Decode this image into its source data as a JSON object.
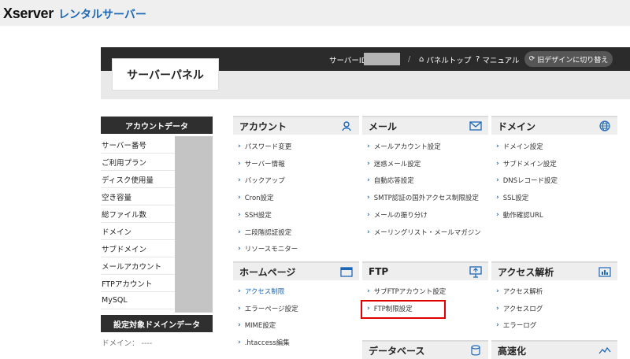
{
  "header": {
    "logo_brand": "Xserver",
    "logo_sub": "レンタルサーバー"
  },
  "panel": {
    "title": "サーバーパネル",
    "server_id_label": "サーバーID",
    "divider": "/",
    "nav_top": "パネルトップ",
    "nav_manual": "マニュアル",
    "old_design_button": "旧デザインに切り替え"
  },
  "account_data": {
    "heading": "アカウントデータ",
    "rows": [
      "サーバー番号",
      "ご利用プラン",
      "ディスク使用量",
      "空き容量",
      "総ファイル数",
      "ドメイン",
      "サブドメイン",
      "メールアカウント",
      "FTPアカウント",
      "MySQL"
    ]
  },
  "target_domain": {
    "heading": "設定対象ドメインデータ",
    "domain_row": "ドメイン： ----"
  },
  "sections": {
    "account": {
      "title": "アカウント",
      "links": [
        "パスワード変更",
        "サーバー情報",
        "バックアップ",
        "Cron設定",
        "SSH設定",
        "二段階認証設定",
        "リソースモニター"
      ]
    },
    "mail": {
      "title": "メール",
      "links": [
        "メールアカウント設定",
        "迷惑メール設定",
        "自動応答設定",
        "SMTP認証の国外アクセス制限設定",
        "メールの振り分け",
        "メーリングリスト・メールマガジン"
      ]
    },
    "domain": {
      "title": "ドメイン",
      "links": [
        "ドメイン設定",
        "サブドメイン設定",
        "DNSレコード設定",
        "SSL設定",
        "動作確認URL"
      ]
    },
    "homepage": {
      "title": "ホームページ",
      "links": [
        "アクセス制限",
        "エラーページ設定",
        "MIME設定",
        ".htaccess編集"
      ]
    },
    "ftp": {
      "title": "FTP",
      "links": [
        "サブFTPアカウント設定",
        "FTP制限設定"
      ]
    },
    "analytics": {
      "title": "アクセス解析",
      "links": [
        "アクセス解析",
        "アクセスログ",
        "エラーログ"
      ]
    },
    "database": {
      "title": "データベース"
    },
    "speedup": {
      "title": "高速化"
    }
  },
  "colors": {
    "accent": "#1c68b8",
    "highlight": "#e00000",
    "dark": "#2b2b2b"
  },
  "icons": {
    "account": "person-icon",
    "mail": "envelope-icon",
    "domain": "globe-icon",
    "homepage": "window-icon",
    "ftp": "monitor-upload-icon",
    "analytics": "bar-chart-icon",
    "database": "database-icon",
    "speedup": "speed-icon"
  }
}
